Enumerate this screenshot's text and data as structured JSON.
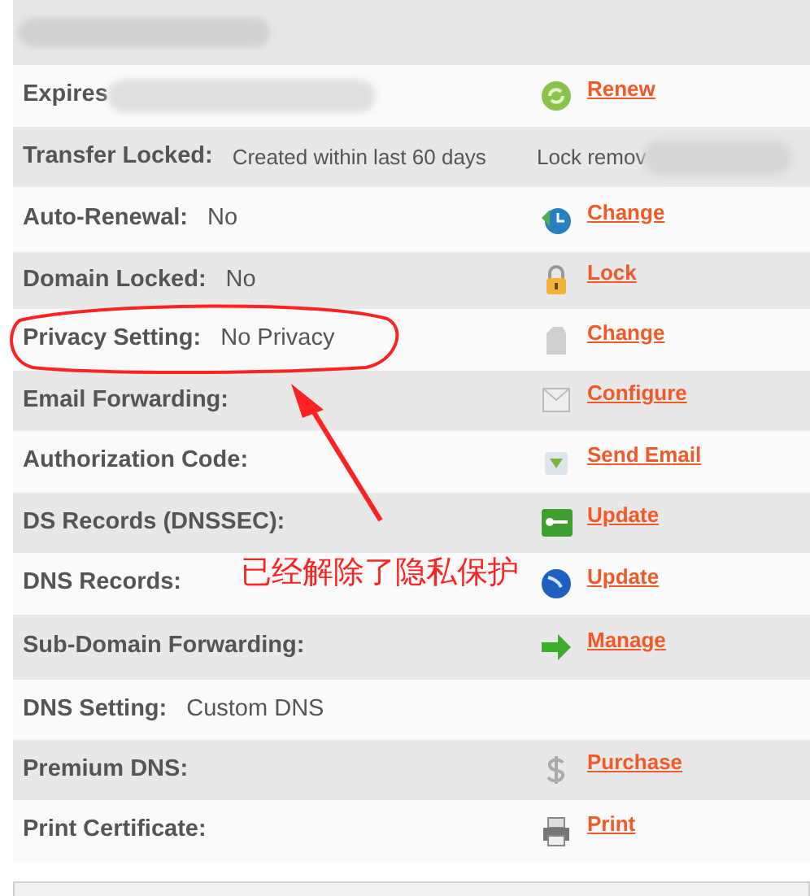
{
  "rows": [
    {
      "label": "Expires",
      "action": {
        "link": "Renew"
      }
    },
    {
      "label": "Transfer Locked:",
      "value": "Created within last 60 days",
      "note": "Lock remov"
    },
    {
      "label": "Auto-Renewal:",
      "value": "No",
      "action": {
        "link": "Change"
      }
    },
    {
      "label": "Domain Locked:",
      "value": "No",
      "action": {
        "link": "Lock"
      }
    },
    {
      "label": "Privacy Setting:",
      "value": "No Privacy",
      "action": {
        "link": "Change"
      }
    },
    {
      "label": "Email Forwarding:",
      "action": {
        "link": "Configure"
      }
    },
    {
      "label": "Authorization Code:",
      "action": {
        "link": "Send Email"
      }
    },
    {
      "label": "DS Records (DNSSEC):",
      "action": {
        "link": "Update"
      }
    },
    {
      "label": "DNS Records:",
      "action": {
        "link": "Update"
      }
    },
    {
      "label": "Sub-Domain Forwarding:",
      "action": {
        "link": "Manage"
      }
    },
    {
      "label": "DNS Setting:",
      "value": "Custom DNS"
    },
    {
      "label": "Premium DNS:",
      "action": {
        "link": "Purchase"
      }
    },
    {
      "label": "Print Certificate:",
      "action": {
        "link": "Print"
      }
    }
  ],
  "annotation": {
    "text": "已经解除了隐私保护"
  }
}
